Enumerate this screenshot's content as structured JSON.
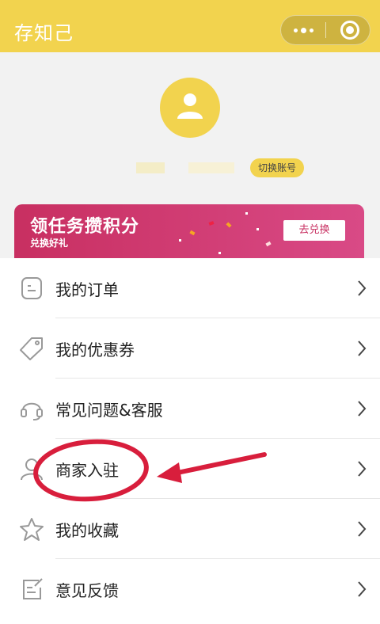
{
  "app": {
    "title": "存知己"
  },
  "profile": {
    "switch_label": "切换账号"
  },
  "banner": {
    "title": "领任务攒积分",
    "subtitle": "兑换好礼",
    "button": "去兑换"
  },
  "menu": [
    {
      "label": "我的订单",
      "icon": "order-icon"
    },
    {
      "label": "我的优惠券",
      "icon": "coupon-icon"
    },
    {
      "label": "常见问题&客服",
      "icon": "headset-icon"
    },
    {
      "label": "商家入驻",
      "icon": "merchant-icon"
    },
    {
      "label": "我的收藏",
      "icon": "star-icon"
    },
    {
      "label": "意见反馈",
      "icon": "feedback-icon"
    }
  ],
  "colors": {
    "brand": "#f2d34e",
    "banner": "#c82f61",
    "annotation": "#d81e3c"
  }
}
